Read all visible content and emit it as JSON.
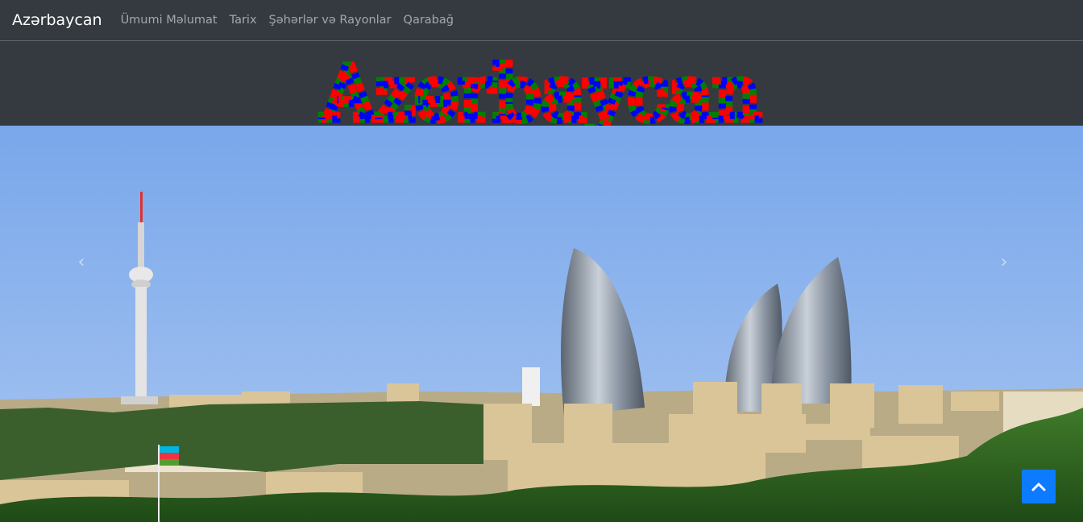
{
  "navbar": {
    "brand": "Azərbaycan",
    "links": [
      "Ümumi Məlumat",
      "Tarix",
      "Şəhərlər və Rayonlar",
      "Qarabağ"
    ]
  },
  "banner": {
    "title": "Azərbaycan",
    "colors": [
      "#ff0000",
      "#0000ff",
      "#008000"
    ]
  },
  "carousel": {
    "prev_icon": "chevron-left-icon",
    "next_icon": "chevron-right-icon",
    "image_subject": "Baku skyline with TV tower and Flame Towers"
  },
  "back_to_top": {
    "icon": "chevron-up-icon",
    "color": "#0d7bff"
  }
}
